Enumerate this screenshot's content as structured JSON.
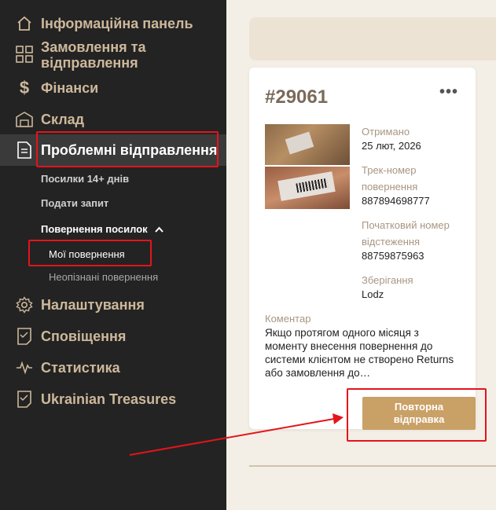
{
  "sidebar": {
    "items": [
      {
        "label": "Інформаційна панель",
        "icon": "home-icon"
      },
      {
        "label": "Замовлення та відправлення",
        "icon": "grid-icon"
      },
      {
        "label": "Фінанси",
        "icon": "dollar-icon"
      },
      {
        "label": "Склад",
        "icon": "warehouse-icon"
      },
      {
        "label": "Проблемні відправлення",
        "icon": "document-icon"
      },
      {
        "label": "Налаштування",
        "icon": "gear-icon"
      },
      {
        "label": "Сповіщення",
        "icon": "notification-list-icon"
      },
      {
        "label": "Статистика",
        "icon": "pulse-icon"
      },
      {
        "label": "Ukrainian Treasures",
        "icon": "store-list-icon"
      }
    ],
    "subitems": {
      "parcels14": "Посилки 14+ днів",
      "submit_request": "Подати запит",
      "returns_group": "Повернення посилок",
      "my_returns": "Мої повернення",
      "unidentified_returns": "Неопізнані повернення"
    }
  },
  "card": {
    "title": "#29061",
    "menu_icon": "more-dots-icon",
    "received_label": "Отримано",
    "received_value": "25 лют, 2026",
    "return_tracking_label_1": "Трек-номер",
    "return_tracking_label_2": "повернення",
    "return_tracking_value": "887894698777",
    "initial_tracking_label_1": "Початковий номер",
    "initial_tracking_label_2": "відстеження",
    "initial_tracking_value": "88759875963",
    "storage_label": "Зберігання",
    "storage_value": "Lodz",
    "comment_label": "Коментар",
    "comment_value": "Якщо протягом одного місяця з моменту внесення повернення до системи клієнтом не створено Returns або замовлення до…",
    "reship_line1": "Повторна",
    "reship_line2": "відправка"
  },
  "colors": {
    "sidebar_bg": "#232323",
    "accent": "#c9a066",
    "highlight": "#e4141b",
    "page_bg": "#f4efe6"
  }
}
